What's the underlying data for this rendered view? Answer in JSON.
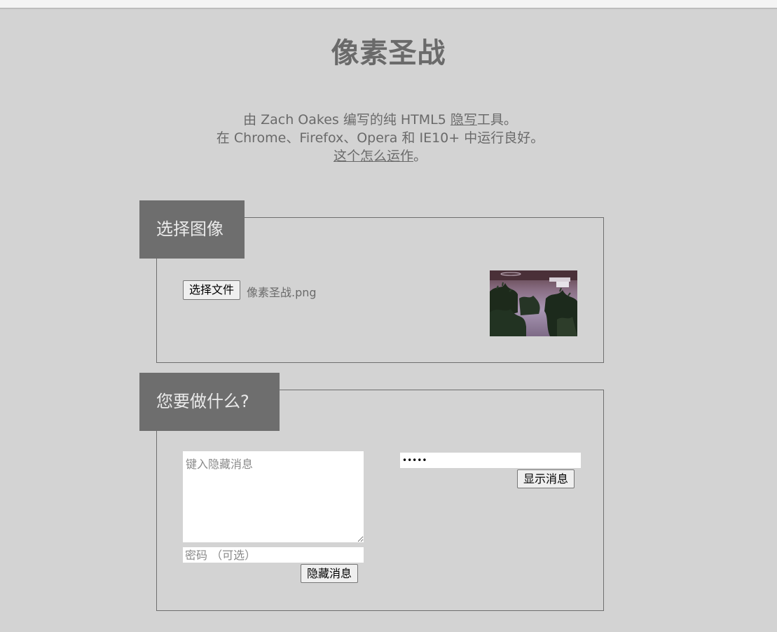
{
  "header": {
    "title": "像素圣战"
  },
  "intro": {
    "line1_prefix": "由 Zach Oakes 编写的纯 HTML5 ",
    "line1_link": "隐写",
    "line1_suffix": "工具。",
    "line2": "在 Chrome、Firefox、Opera 和 IE10+ 中运行良好。",
    "line3_link": "这个怎么运作",
    "line3_suffix": "。"
  },
  "choose_image": {
    "heading": "选择图像",
    "file_button_label": "选择文件",
    "file_name": "像素圣战.png"
  },
  "actions": {
    "heading": "您要做什么?",
    "message_placeholder": "键入隐藏消息",
    "hide_password_placeholder": "密码 （可选）",
    "hide_button_label": "隐藏消息",
    "show_password_value": "•••••",
    "show_button_label": "显示消息"
  }
}
